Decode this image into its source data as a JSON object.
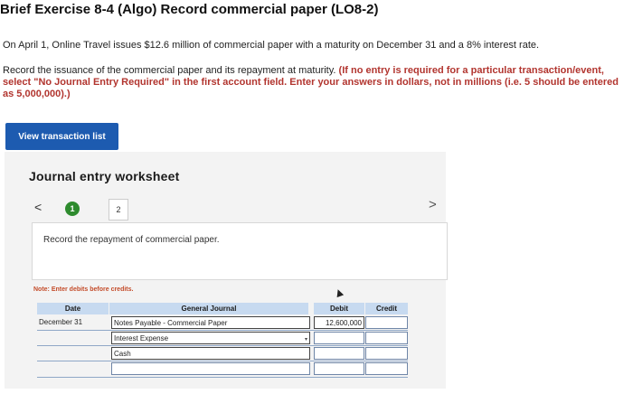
{
  "header": {
    "title": "Brief Exercise 8-4 (Algo) Record commercial paper (LO8-2)"
  },
  "problem": {
    "intro": "On April 1, Online Travel issues $12.6 million of commercial paper with a maturity on December 31 and a 8% interest rate.",
    "instruction_plain": "Record the issuance of the commercial paper and its repayment at maturity. ",
    "instruction_bold": "(If no entry is required for a particular transaction/event, select \"No Journal Entry Required\" in the first account field. Enter your answers in dollars, not in millions (i.e. 5 should be entered as 5,000,000).)"
  },
  "buttons": {
    "view_transaction_list": "View transaction list"
  },
  "worksheet": {
    "title": "Journal entry worksheet",
    "prev_icon": "chevron-left-icon",
    "next_icon": "chevron-right-icon",
    "steps": [
      "1",
      "2"
    ],
    "active_step": 1,
    "prompt": "Record the repayment of commercial paper.",
    "note": "Note: Enter debits before credits.",
    "columns": {
      "date": "Date",
      "account": "General Journal",
      "debit": "Debit",
      "credit": "Credit"
    },
    "rows": [
      {
        "date": "December 31",
        "account": "Notes Payable - Commercial Paper",
        "debit": "12,600,000",
        "credit": ""
      },
      {
        "date": "",
        "account": "Interest Expense",
        "debit": "",
        "credit": ""
      },
      {
        "date": "",
        "account": "Cash",
        "debit": "",
        "credit": ""
      },
      {
        "date": "",
        "account": "",
        "debit": "",
        "credit": ""
      }
    ]
  },
  "colors": {
    "button_blue": "#1d5bb0",
    "step_green": "#2e8b2e",
    "note_orange": "#c44c2a",
    "header_blue": "#c7daf0"
  }
}
